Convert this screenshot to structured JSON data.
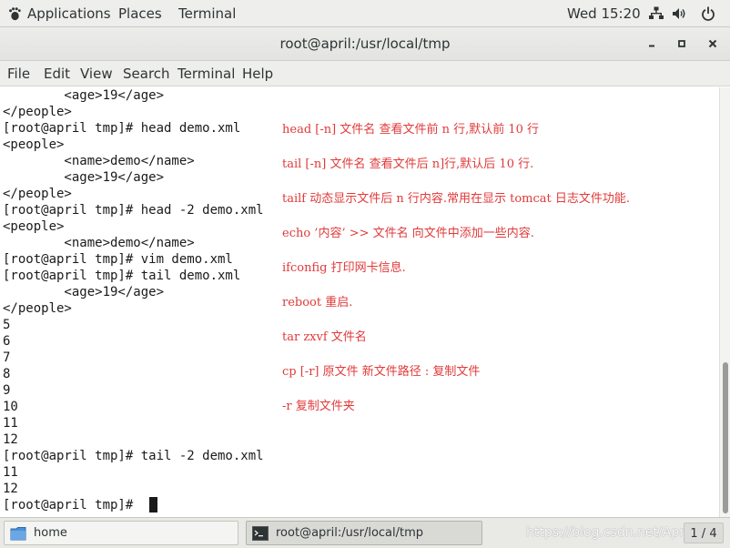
{
  "top_bar": {
    "applications_label": "Applications",
    "places_label": "Places",
    "terminal_label": "Terminal",
    "clock": "Wed 15:20"
  },
  "window": {
    "title": "root@april:/usr/local/tmp"
  },
  "menu": {
    "items": [
      "File",
      "Edit",
      "View",
      "Search",
      "Terminal",
      "Help"
    ]
  },
  "terminal": {
    "lines": [
      "        <age>19</age>",
      "</people>",
      "[root@april tmp]# head demo.xml",
      "<people>",
      "        <name>demo</name>",
      "        <age>19</age>",
      "</people>",
      "[root@april tmp]# head -2 demo.xml",
      "<people>",
      "        <name>demo</name>",
      "[root@april tmp]# vim demo.xml",
      "[root@april tmp]# tail demo.xml",
      "        <age>19</age>",
      "</people>",
      "5",
      "6",
      "7",
      "8",
      "9",
      "10",
      "11",
      "12",
      "[root@april tmp]# tail -2 demo.xml",
      "11",
      "12",
      "[root@april tmp]# "
    ]
  },
  "notes": [
    "head [-n] 文件名 查看文件前 n 行,默认前 10 行",
    "tail [-n] 文件名 查看文件后 n]行,默认后 10 行.",
    "tailf 动态显示文件后 n 行内容.常用在显示 tomcat 日志文件功能.",
    "echo ’内容’ >> 文件名 向文件中添加一些内容.",
    "ifconfig 打印网卡信息.",
    "reboot 重启.",
    "tar zxvf 文件名",
    "cp [-r] 原文件 新文件路径 : 复制文件",
    "-r 复制文件夹"
  ],
  "taskbar": {
    "home_label": "home",
    "terminal_label": "root@april:/usr/local/tmp",
    "watermark": "https://blog.csdn.net/April",
    "workspace": "1 / 4"
  },
  "colors": {
    "annotation_text": "#e03a3a",
    "terminal_text": "#1a1a1a",
    "panel_bg": "#eeeeec"
  },
  "icons": {
    "top_bar": [
      "gnome-foot-icon",
      "network-icon",
      "volume-icon",
      "power-icon"
    ],
    "window": [
      "minimize-icon",
      "maximize-icon",
      "close-icon"
    ],
    "taskbar": [
      "folder-icon",
      "terminal-icon"
    ]
  }
}
